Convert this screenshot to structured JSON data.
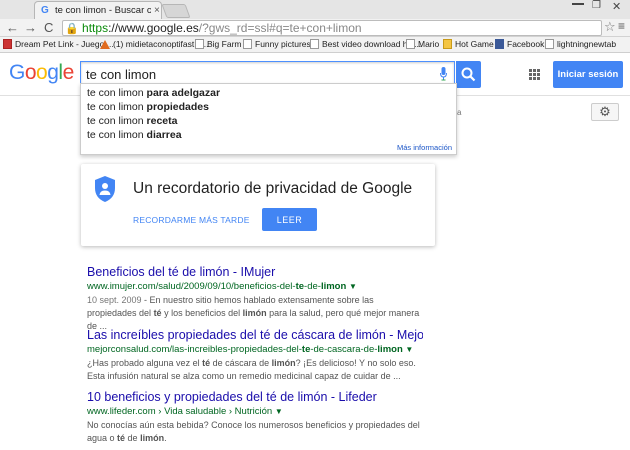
{
  "browser": {
    "tab_title": "te con limon - Buscar con Go",
    "tab_close": "×",
    "url_secure": "https",
    "url_host": "://www.google.es",
    "url_rest": "/?gws_rd=ssl#q=te+con+limon",
    "back": "←",
    "forward": "→",
    "reload": "C",
    "min": "",
    "max": "❐",
    "close": "✕",
    "star": "☆",
    "menu": "≡"
  },
  "bookmarks": [
    {
      "label": "Dream Pet Link - Juego ..."
    },
    {
      "label": "(1) midietaconoptifast.b..."
    },
    {
      "label": "Big Farm"
    },
    {
      "label": "Funny pictures"
    },
    {
      "label": "Best video download hel..."
    },
    {
      "label": "Mario"
    },
    {
      "label": "Hot Game"
    },
    {
      "label": "Facebook"
    },
    {
      "label": "lightningnewtab"
    }
  ],
  "header": {
    "logo": [
      "G",
      "o",
      "o",
      "g",
      "l",
      "e"
    ],
    "query": "te con limon",
    "signin": "Iniciar sesión"
  },
  "suggestions": [
    {
      "prefix": "te con limon ",
      "bold": "para adelgazar"
    },
    {
      "prefix": "te con limon ",
      "bold": "propiedades"
    },
    {
      "prefix": "te con limon ",
      "bold": "receta"
    },
    {
      "prefix": "te con limon ",
      "bold": "diarrea"
    }
  ],
  "suggest_more": "Más información",
  "hidden_tab_text": "a",
  "privacy": {
    "title": "Un recordatorio de privacidad de Google",
    "remind": "RECORDARME MÁS TARDE",
    "read": "LEER"
  },
  "results": [
    {
      "title": "Beneficios del té de limón - IMujer",
      "url_pre": "www.imujer.com/salud/2009/09/10/beneficios-del-",
      "url_b1": "te",
      "url_mid": "-de-",
      "url_b2": "limon",
      "date": "10 sept. 2009",
      "snip1": " - En nuestro sitio hemos hablado extensamente sobre las propiedades del ",
      "snip_b1": "té",
      "snip2": " y los beneficios del ",
      "snip_b2": "limón",
      "snip3": " para la salud, pero qué mejor manera de ..."
    },
    {
      "title": "Las increíbles propiedades del té de cáscara de limón - Mejor ...",
      "url_pre": "mejorconsalud.com/las-increibles-propiedades-del-",
      "url_b1": "te",
      "url_mid": "-de-cascara-de-",
      "url_b2": "limon",
      "snip1": "¿Has probado alguna vez el ",
      "snip_b1": "té",
      "snip2": " de cáscara de ",
      "snip_b2": "limón",
      "snip3": "? ¡Es delicioso! Y no solo eso. Esta infusión natural se alza como un remedio medicinal capaz de cuidar de ..."
    },
    {
      "title": "10 beneficios y propiedades del té de limón - Lifeder",
      "url_pre": "www.lifeder.com › Vida saludable › Nutrición",
      "snip1": "No conocías aún esta bebida? Conoce los numerosos beneficios y propiedades del agua o ",
      "snip_b1": "té",
      "snip2": " de ",
      "snip_b2": "limón",
      "snip3": "."
    }
  ],
  "colors": {
    "link": "#1a0dab",
    "url": "#006621",
    "accent": "#4285f4"
  }
}
